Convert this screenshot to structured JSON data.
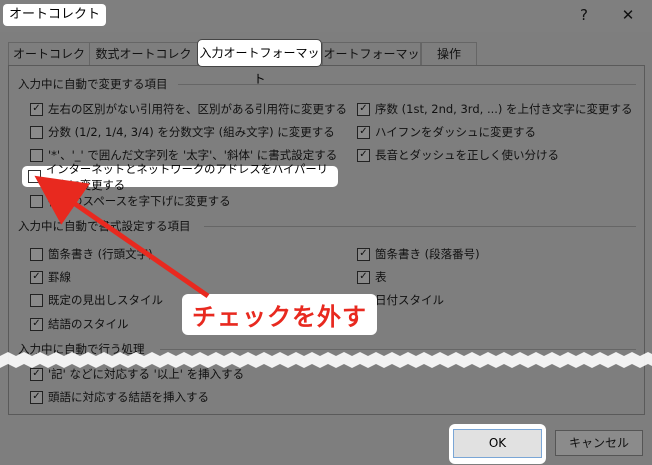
{
  "window": {
    "title": "オートコレクト",
    "help": "?",
    "close": "✕"
  },
  "tabs": [
    "オートコレクト",
    "数式オートコレクト",
    "入力オートフォーマット",
    "オートフォーマット",
    "操作"
  ],
  "sections": {
    "replace": "入力中に自動で変更する項目",
    "format": "入力中に自動で書式設定する項目",
    "apply": "入力中に自動で行う処理"
  },
  "replace_left": [
    {
      "label": "左右の区別がない引用符を、区別がある引用符に変更する",
      "checked": true
    },
    {
      "label": "分数 (1/2, 1/4, 3/4) を分数文字 (組み文字) に変更する",
      "checked": false
    },
    {
      "label": "'*'、'_' で囲んだ文字列を '太字'、'斜体' に書式設定する",
      "checked": false
    },
    {
      "label": "インターネットとネットワークのアドレスをハイパーリンクに変更する",
      "checked": false
    },
    {
      "label": "行頭のスペースを字下げに変更する",
      "checked": false
    }
  ],
  "replace_right": [
    {
      "label": "序数 (1st, 2nd, 3rd, ...) を上付き文字に変更する",
      "checked": true
    },
    {
      "label": "ハイフンをダッシュに変更する",
      "checked": true
    },
    {
      "label": "長音とダッシュを正しく使い分ける",
      "checked": true
    }
  ],
  "format_left": [
    {
      "label": "箇条書き (行頭文字)",
      "checked": false
    },
    {
      "label": "罫線",
      "checked": true
    },
    {
      "label": "既定の見出しスタイル",
      "checked": false
    },
    {
      "label": "結語のスタイル",
      "checked": true
    }
  ],
  "format_right": [
    {
      "label": "箇条書き (段落番号)",
      "checked": true
    },
    {
      "label": "表",
      "checked": true
    },
    {
      "label": "日付スタイル",
      "checked": false
    }
  ],
  "apply_items": [
    {
      "label": "'記' などに対応する '以上' を挿入する",
      "checked": true
    },
    {
      "label": "頭語に対応する結語を挿入する",
      "checked": true
    }
  ],
  "buttons": {
    "ok": "OK",
    "cancel": "キャンセル"
  },
  "annotation": {
    "text": "チェックを外す",
    "color": "#e8291f"
  },
  "icons": {
    "check": "✓"
  }
}
